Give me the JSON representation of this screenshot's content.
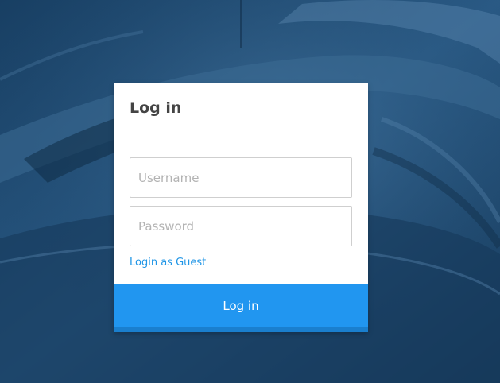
{
  "login": {
    "title": "Log in",
    "username_placeholder": "Username",
    "username_value": "",
    "password_placeholder": "Password",
    "password_value": "",
    "guest_link": "Login as Guest",
    "submit_label": "Log in"
  },
  "colors": {
    "accent": "#2196f0",
    "link": "#2196e6",
    "background": "#1f4a72",
    "card": "#ffffff"
  }
}
